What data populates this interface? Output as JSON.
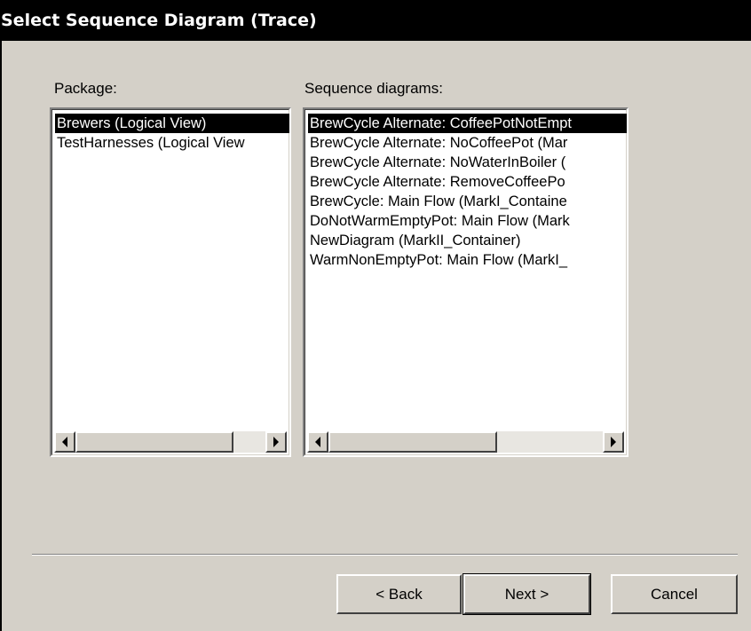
{
  "window": {
    "title": "Select Sequence Diagram (Trace)"
  },
  "package_panel": {
    "label": "Package:",
    "items": [
      {
        "label": "Brewers (Logical View)",
        "selected": true
      },
      {
        "label": "TestHarnesses (Logical View",
        "selected": false
      }
    ]
  },
  "diagrams_panel": {
    "label": "Sequence diagrams:",
    "items": [
      {
        "label": "BrewCycle Alternate: CoffeePotNotEmpt",
        "selected": true
      },
      {
        "label": "BrewCycle Alternate: NoCoffeePot (Mar",
        "selected": false
      },
      {
        "label": "BrewCycle Alternate: NoWaterInBoiler (",
        "selected": false
      },
      {
        "label": "BrewCycle Alternate: RemoveCoffeePo",
        "selected": false
      },
      {
        "label": "BrewCycle: Main Flow (MarkI_Containe",
        "selected": false
      },
      {
        "label": "DoNotWarmEmptyPot: Main Flow (Mark",
        "selected": false
      },
      {
        "label": "NewDiagram (MarkII_Container)",
        "selected": false
      },
      {
        "label": "WarmNonEmptyPot: Main Flow (MarkI_",
        "selected": false
      }
    ]
  },
  "buttons": {
    "back": "< Back",
    "next": "Next >",
    "cancel": "Cancel"
  },
  "colors": {
    "dialog_background": "#d4d0c8",
    "title_background": "#000000",
    "selection_background": "#000000"
  }
}
